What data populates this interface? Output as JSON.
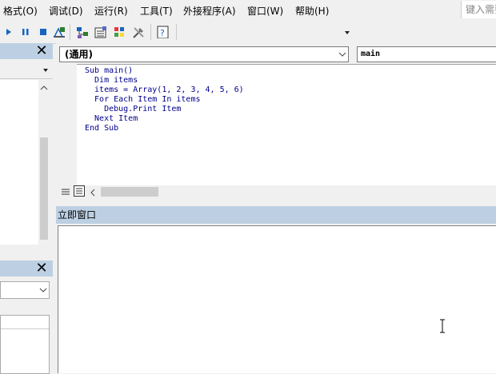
{
  "menu": {
    "items": [
      "格式(O)",
      "调试(D)",
      "运行(R)",
      "工具(T)",
      "外接程序(A)",
      "窗口(W)",
      "帮助(H)"
    ],
    "search_placeholder": "键入需要"
  },
  "code_window": {
    "object_combo": "(通用)",
    "procedure_combo": "main",
    "code_lines": [
      "Sub main()",
      "  Dim items",
      "  items = Array(1, 2, 3, 4, 5, 6)",
      "  For Each Item In items",
      "    Debug.Print Item",
      "  Next Item",
      "End Sub"
    ]
  },
  "immediate_window": {
    "title": "立即窗口"
  },
  "icons": {
    "run": "run-icon",
    "break": "break-icon",
    "reset": "reset-icon",
    "design_mode": "design-mode-icon",
    "project_explorer": "project-explorer-icon",
    "properties": "properties-icon",
    "object_browser": "object-browser-icon",
    "toolbox": "toolbox-icon",
    "help": "help-icon"
  },
  "colors": {
    "panel_title": "#bdd0e3",
    "run_blue": "#1565c0",
    "code_text": "#00008b"
  }
}
